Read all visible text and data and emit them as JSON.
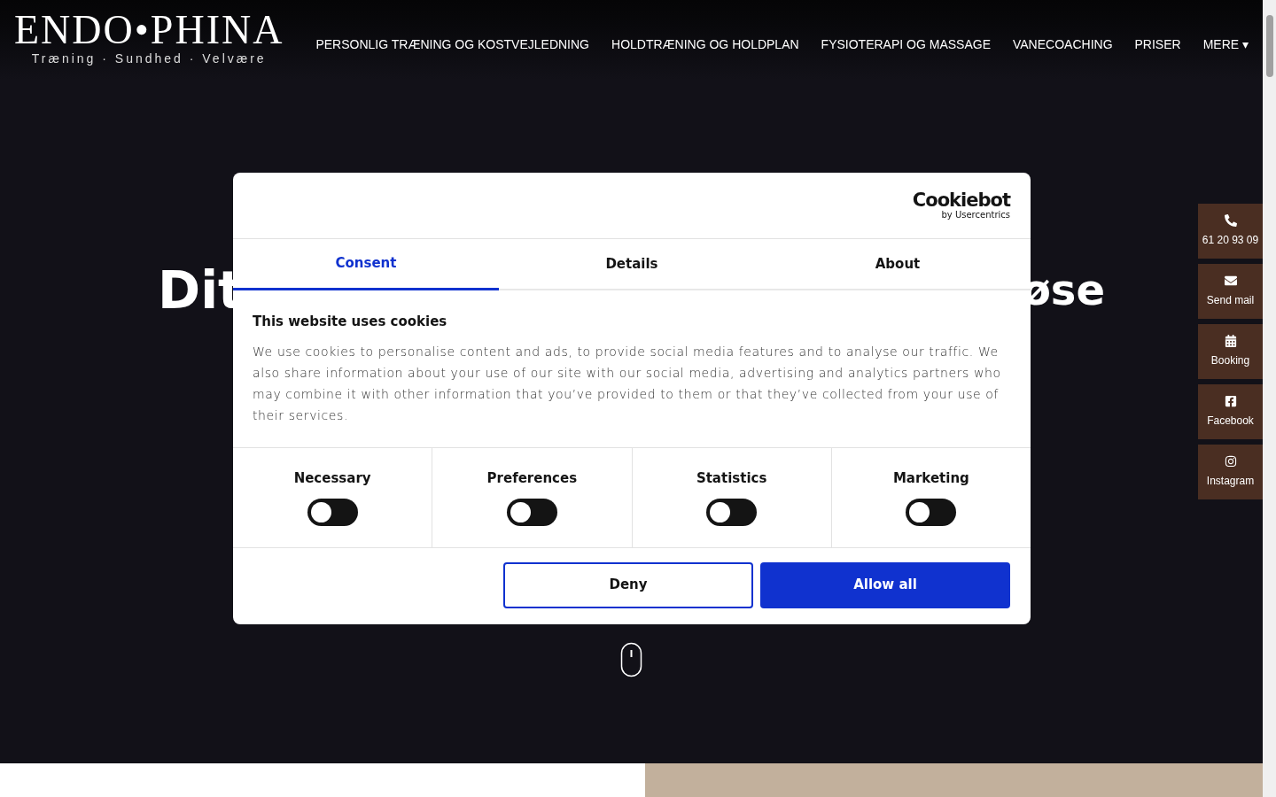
{
  "header": {
    "logo": {
      "name": "ENDO•PHINA",
      "tagline": "Træning · Sundhed · Velvære"
    },
    "nav": [
      {
        "label": "PERSONLIG TRÆNING OG KOSTVEJLEDNING"
      },
      {
        "label": "HOLDTRÆNING OG HOLDPLAN"
      },
      {
        "label": "FYSIOTERAPI OG MASSAGE"
      },
      {
        "label": "VANECOACHING"
      },
      {
        "label": "PRISER"
      },
      {
        "label": "MERE ▾"
      }
    ]
  },
  "hero": {
    "heading_start": "Dit",
    "heading_end": "øse"
  },
  "contact_buttons": [
    {
      "kind": "phone",
      "label": "61 20 93 09"
    },
    {
      "kind": "mail",
      "label": "Send mail"
    },
    {
      "kind": "booking",
      "label": "Booking"
    },
    {
      "kind": "facebook",
      "label": "Facebook"
    },
    {
      "kind": "instagram",
      "label": "Instagram"
    }
  ],
  "cookie_dialog": {
    "brand": {
      "name": "Cookiebot",
      "byline": "by Usercentrics"
    },
    "tabs": [
      {
        "label": "Consent",
        "selected": true
      },
      {
        "label": "Details",
        "selected": false
      },
      {
        "label": "About",
        "selected": false
      }
    ],
    "title": "This website uses cookies",
    "text": "We use cookies to personalise content and ads, to provide social media features and to analyse our traffic. We also share information about your use of our site with our social media, advertising and analytics partners who may combine it with other information that you’ve provided to them or that they’ve collected from your use of their services.",
    "categories": [
      {
        "label": "Necessary",
        "on": false
      },
      {
        "label": "Preferences",
        "on": false
      },
      {
        "label": "Statistics",
        "on": false
      },
      {
        "label": "Marketing",
        "on": false
      }
    ],
    "buttons": [
      {
        "kind": "secondary",
        "label": "Deny"
      },
      {
        "kind": "primary",
        "label": "Allow all"
      }
    ]
  }
}
